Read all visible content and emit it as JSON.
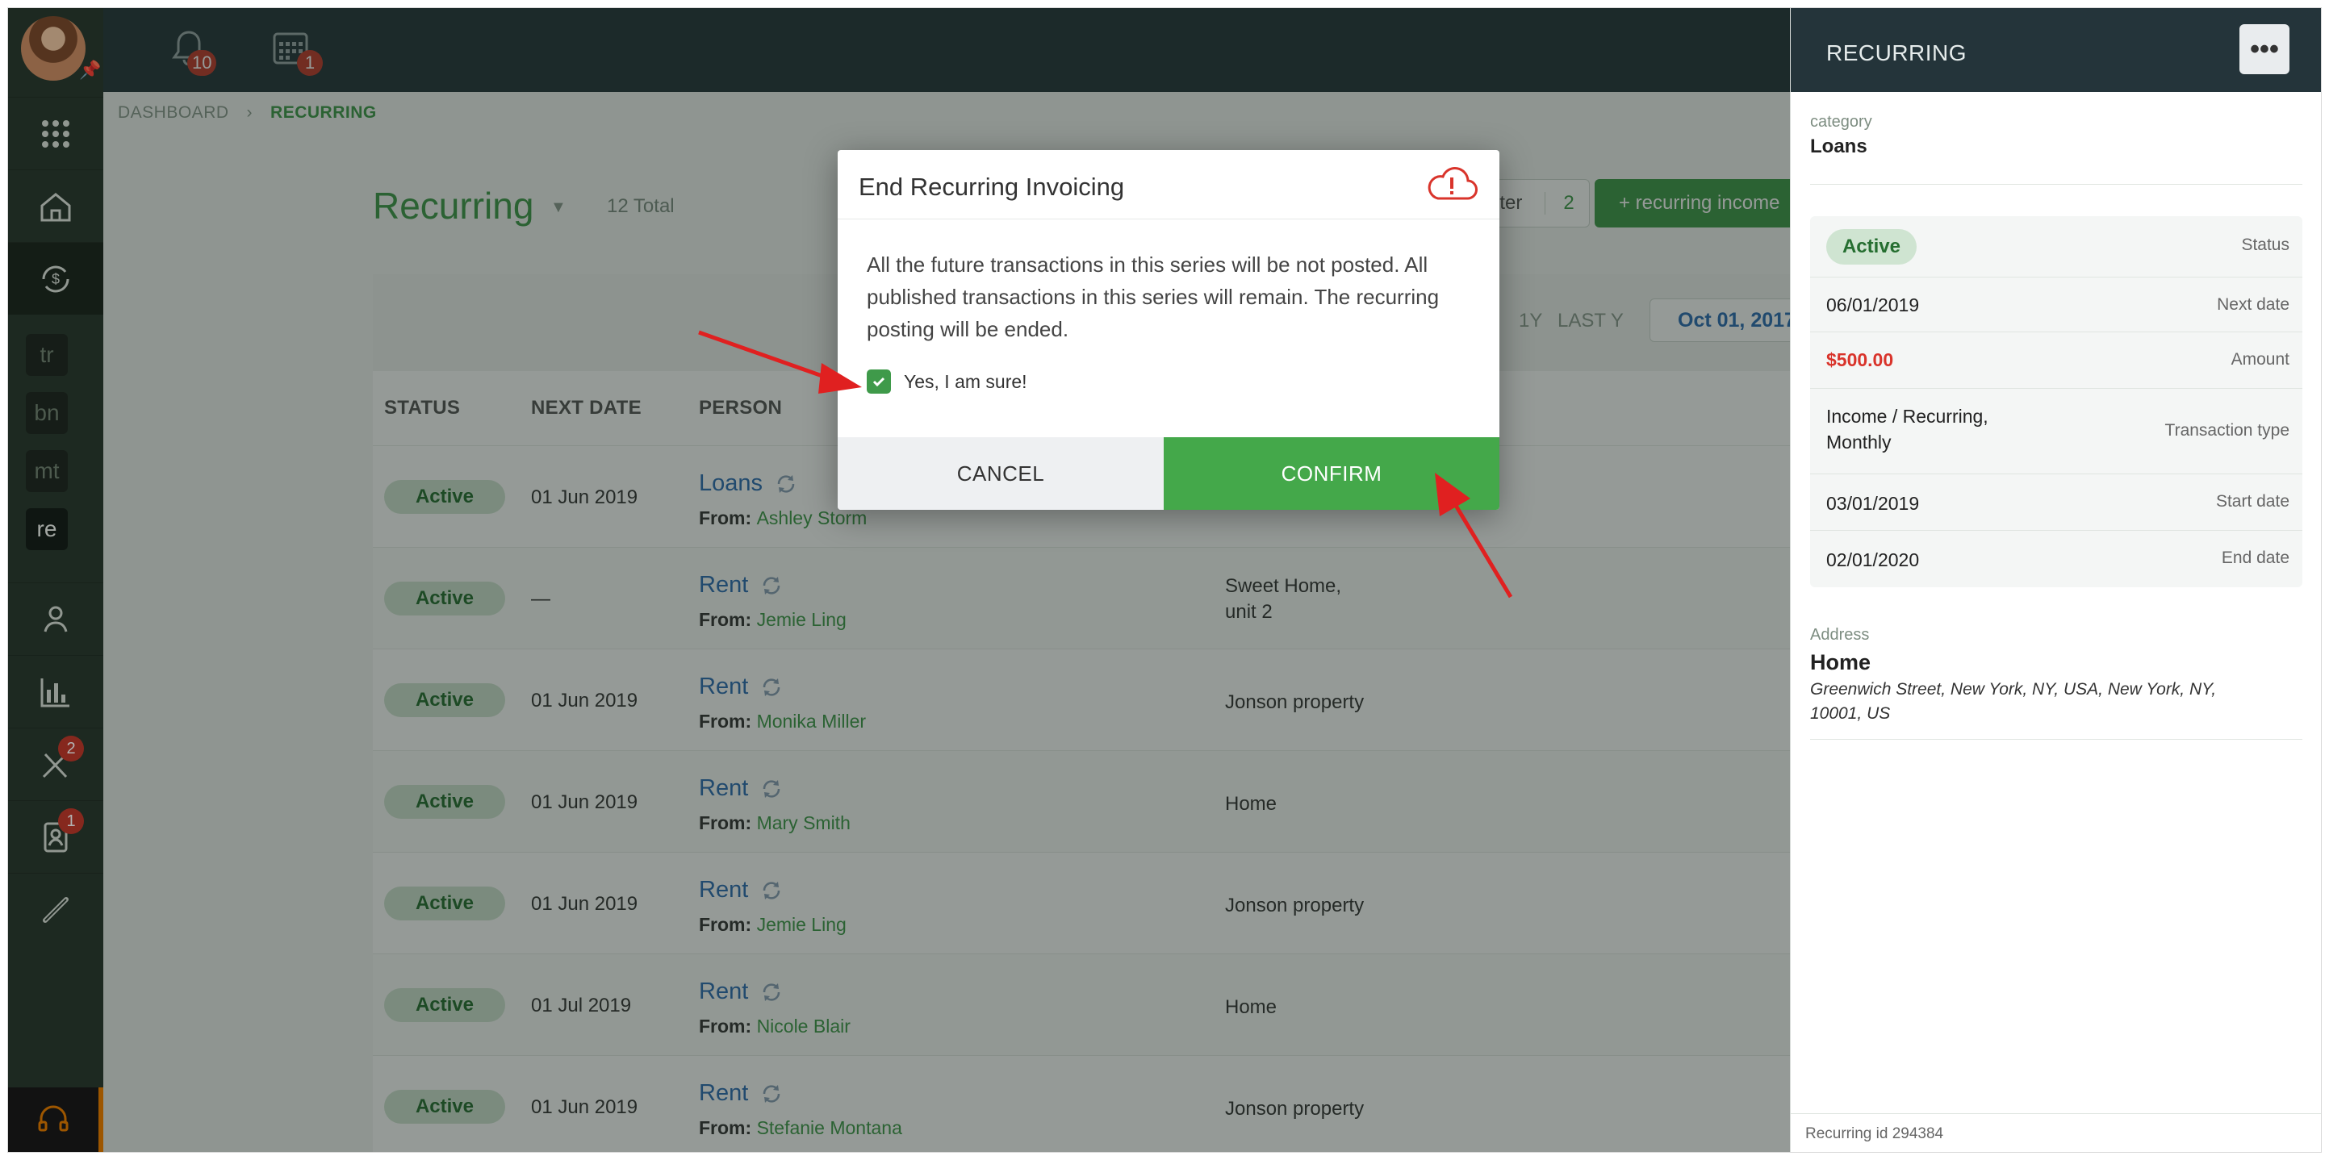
{
  "topbar": {
    "notifications_count": "10",
    "calendar_count": "1"
  },
  "sidebar": {
    "tags": [
      "tr",
      "bn",
      "mt",
      "re"
    ],
    "tools_badge": "2",
    "contacts_badge": "1"
  },
  "breadcrumb": {
    "root": "DASHBOARD",
    "current": "RECURRING"
  },
  "page": {
    "title": "Recurring",
    "total": "12 Total",
    "filter_label": "lter",
    "filter_count": "2",
    "add_label": "+ recurring income"
  },
  "toolbar": {
    "periods": [
      "1Y",
      "LAST Y"
    ],
    "date_range": "Oct 01, 2017"
  },
  "table": {
    "headers": {
      "status": "STATUS",
      "next_date": "NEXT DATE",
      "person": "PERSON"
    },
    "from_label": "From:",
    "rows": [
      {
        "status": "Active",
        "next_date": "01 Jun 2019",
        "category": "Loans",
        "from": "Ashley Storm",
        "property": ""
      },
      {
        "status": "Active",
        "next_date": "—",
        "category": "Rent",
        "from": "Jemie Ling",
        "property": "Sweet Home,\nunit 2"
      },
      {
        "status": "Active",
        "next_date": "01 Jun 2019",
        "category": "Rent",
        "from": "Monika Miller",
        "property": "Jonson property"
      },
      {
        "status": "Active",
        "next_date": "01 Jun 2019",
        "category": "Rent",
        "from": "Mary Smith",
        "property": "Home"
      },
      {
        "status": "Active",
        "next_date": "01 Jun 2019",
        "category": "Rent",
        "from": "Jemie Ling",
        "property": "Jonson property"
      },
      {
        "status": "Active",
        "next_date": "01 Jul 2019",
        "category": "Rent",
        "from": "Nicole Blair",
        "property": "Home"
      },
      {
        "status": "Active",
        "next_date": "01 Jun 2019",
        "category": "Rent",
        "from": "Stefanie Montana",
        "property": "Jonson property"
      }
    ]
  },
  "panel": {
    "title": "RECURRING",
    "category_label": "category",
    "category_value": "Loans",
    "status_value": "Active",
    "status_label": "Status",
    "next_date_value": "06/01/2019",
    "next_date_label": "Next date",
    "amount_value": "$500.00",
    "amount_label": "Amount",
    "transaction_type_value": "Income / Recurring, Monthly",
    "transaction_type_label": "Transaction type",
    "start_date_value": "03/01/2019",
    "start_date_label": "Start date",
    "end_date_value": "02/01/2020",
    "end_date_label": "End date",
    "address_label": "Address",
    "address_name": "Home",
    "address_line": "Greenwich Street, New York, NY, USA, New York, NY, 10001, US",
    "footer": "Recurring id 294384"
  },
  "modal": {
    "title": "End Recurring Invoicing",
    "body": "All the future transactions in this series will be not posted. All published transactions in this series will remain. The recurring posting will be ended.",
    "checkbox_label": "Yes, I am sure!",
    "cancel_label": "CANCEL",
    "confirm_label": "CONFIRM"
  },
  "colors": {
    "brand_green": "#3f9a4a",
    "topbar": "#24343a",
    "sidebar": "#2a3b2f",
    "amount_red": "#d9342b",
    "link_blue": "#2d6db5",
    "annotation_red": "#e02020"
  }
}
